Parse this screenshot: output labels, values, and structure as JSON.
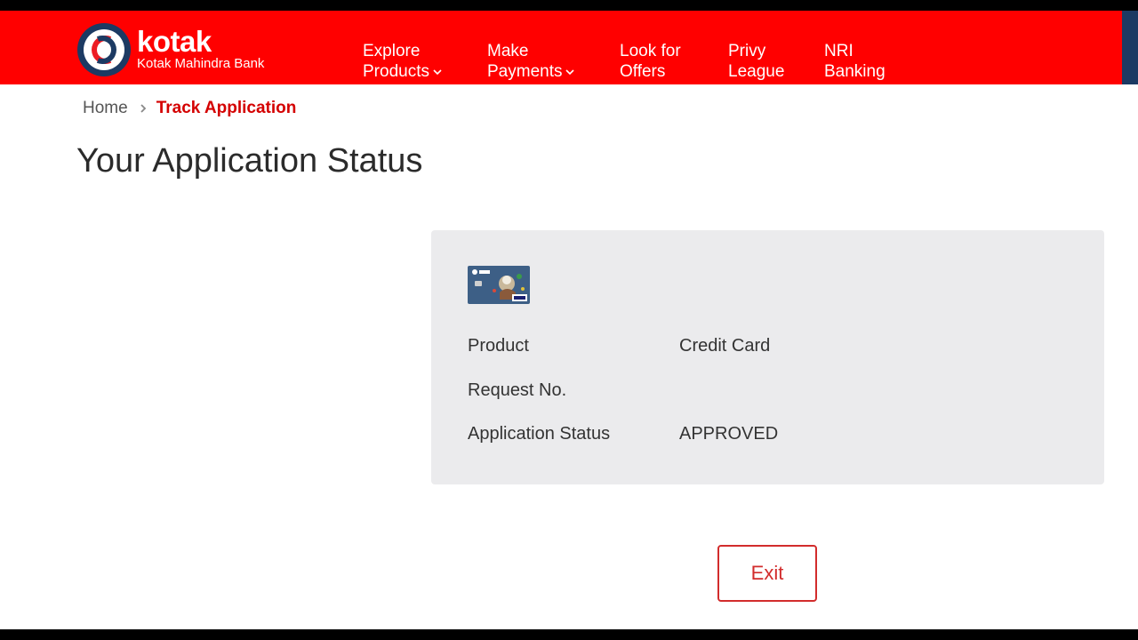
{
  "brand": {
    "name": "kotak",
    "subtitle": "Kotak Mahindra Bank",
    "primary_color": "#ff0000",
    "accent_color": "#d22c2c"
  },
  "nav": {
    "items": [
      {
        "line1": "Explore",
        "line2": "Products",
        "has_dropdown": true
      },
      {
        "line1": "Make",
        "line2": "Payments",
        "has_dropdown": true
      },
      {
        "line1": "Look for",
        "line2": "Offers",
        "has_dropdown": false
      },
      {
        "line1": "Privy",
        "line2": "League",
        "has_dropdown": false
      },
      {
        "line1": "NRI",
        "line2": "Banking",
        "has_dropdown": false
      }
    ]
  },
  "breadcrumb": {
    "home": "Home",
    "current": "Track Application",
    "separator_icon": "chevron-right-icon"
  },
  "page": {
    "title": "Your Application Status"
  },
  "details": {
    "card_image": "credit-card-image",
    "rows": [
      {
        "label": "Product",
        "value": "Credit Card"
      },
      {
        "label": "Request No.",
        "value": ""
      },
      {
        "label": "Application Status",
        "value": "APPROVED"
      }
    ]
  },
  "actions": {
    "exit_label": "Exit"
  }
}
